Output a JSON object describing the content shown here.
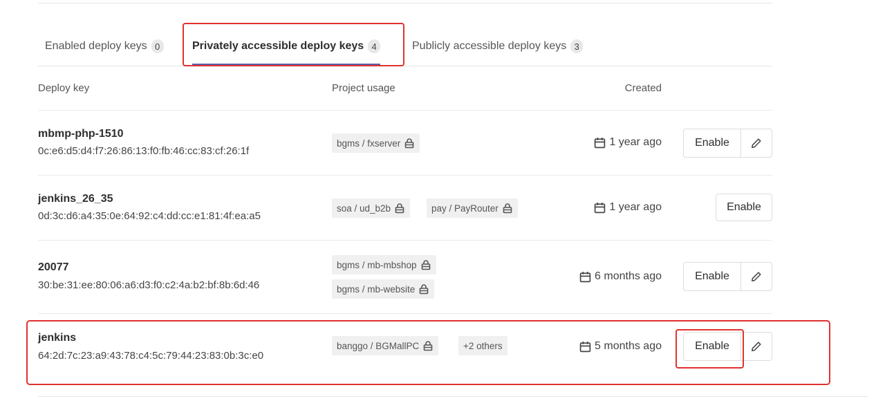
{
  "tabs": [
    {
      "label": "Enabled deploy keys",
      "count": "0"
    },
    {
      "label": "Privately accessible deploy keys",
      "count": "4"
    },
    {
      "label": "Publicly accessible deploy keys",
      "count": "3"
    }
  ],
  "table": {
    "headers": {
      "deploy_key": "Deploy key",
      "project_usage": "Project usage",
      "created": "Created"
    },
    "rows": [
      {
        "title": "mbmp-php-1510",
        "fingerprint": "0c:e6:d5:d4:f7:26:86:13:f0:fb:46:cc:83:cf:26:1f",
        "projects": [
          "bgms / fxserver"
        ],
        "created": "1 year ago",
        "enable_label": "Enable",
        "has_edit": true
      },
      {
        "title": "jenkins_26_35",
        "fingerprint": "0d:3c:d6:a4:35:0e:64:92:c4:dd:cc:e1:81:4f:ea:a5",
        "projects": [
          "soa / ud_b2b",
          "pay / PayRouter"
        ],
        "created": "1 year ago",
        "enable_label": "Enable",
        "has_edit": false
      },
      {
        "title": "20077",
        "fingerprint": "30:be:31:ee:80:06:a6:d3:f0:c2:4a:b2:bf:8b:6d:46",
        "projects": [
          "bgms / mb-mbshop",
          "bgms / mb-website"
        ],
        "created": "6 months ago",
        "enable_label": "Enable",
        "has_edit": true
      },
      {
        "title": "jenkins",
        "fingerprint": "64:2d:7c:23:a9:43:78:c4:5c:79:44:23:83:0b:3c:e0",
        "projects": [
          "banggo / BGMallPC"
        ],
        "others": "+2 others",
        "created": "5 months ago",
        "enable_label": "Enable",
        "has_edit": true
      }
    ]
  },
  "icons": {
    "lock": "lock-icon",
    "calendar": "calendar-icon",
    "edit": "pencil-icon"
  },
  "colors": {
    "highlight": "#e0322f",
    "active_tab_underline": "#5b5ea8"
  }
}
